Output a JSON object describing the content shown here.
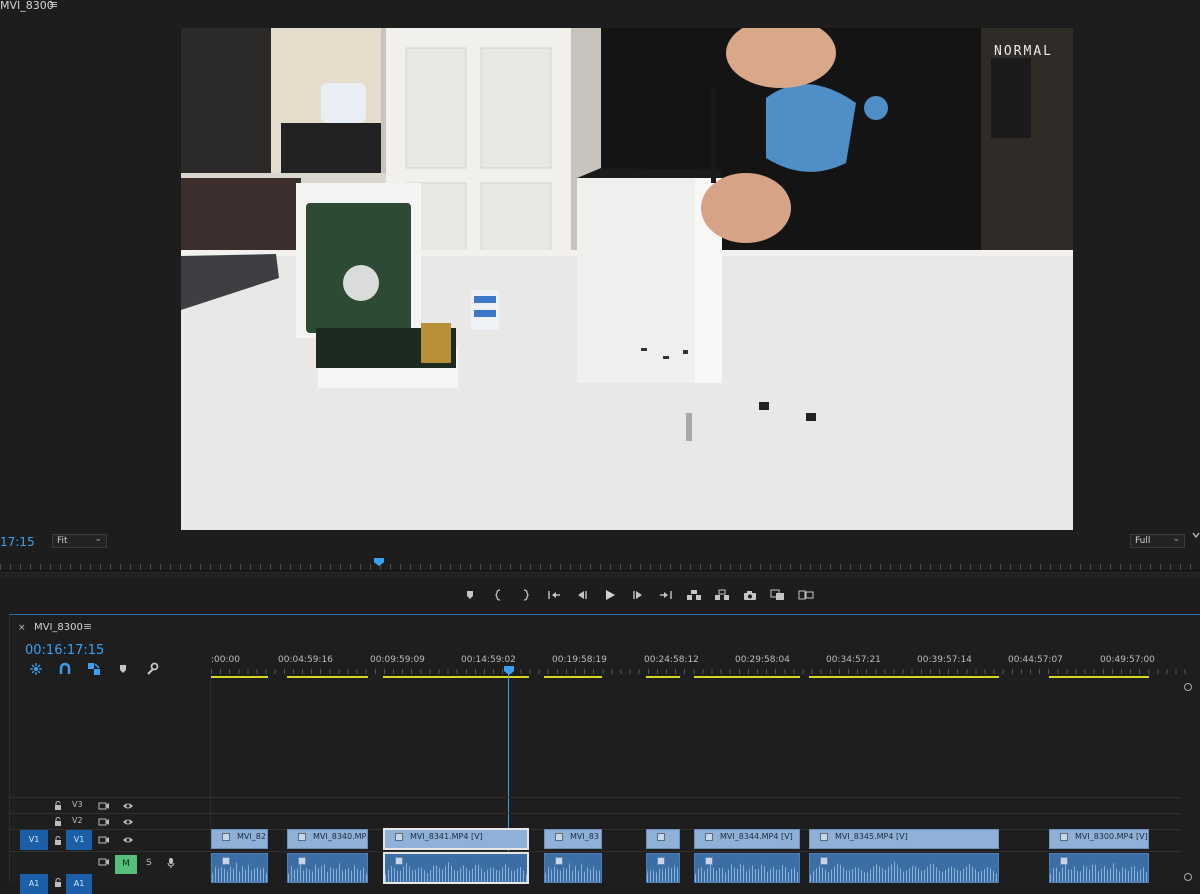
{
  "monitor": {
    "title": "MVI_8300",
    "menu_glyph": "≡",
    "mode_label": "NORMAL",
    "timecode": "17:15",
    "fit_option": "Fit",
    "quality_option": "Full",
    "dropdown_chevron": "⌄"
  },
  "transport": {
    "buttons": [
      "add-marker",
      "mark-in",
      "mark-out",
      "go-to-in",
      "step-back",
      "play",
      "step-forward",
      "go-to-out",
      "lift",
      "extract",
      "export-frame",
      "comparison-view",
      "toggle-proxies"
    ]
  },
  "timeline": {
    "close_glyph": "×",
    "sequence_name": "MVI_8300",
    "menu_glyph": "≡",
    "timecode": "00:16:17:15",
    "ruler_labels": [
      ":00:00",
      "00:04:59:16",
      "00:09:59:09",
      "00:14:59:02",
      "00:19:58:19",
      "00:24:58:12",
      "00:29:58:04",
      "00:34:57:21",
      "00:39:57:14",
      "00:44:57:07",
      "00:49:57:00"
    ],
    "tracks": {
      "v3": {
        "name": "V3"
      },
      "v2": {
        "name": "V2"
      },
      "v1": {
        "name": "V1",
        "source_patch": "V1"
      },
      "a1": {
        "name": "A1",
        "source_patch": "A1",
        "mute": "M",
        "solo": "S"
      }
    },
    "video_clips": [
      {
        "label": "MVI_82"
      },
      {
        "label": "MVI_8340.MP4"
      },
      {
        "label": "MVI_8341.MP4 [V]",
        "selected": true
      },
      {
        "label": "MVI_83"
      },
      {
        "label": ""
      },
      {
        "label": "MVI_8344.MP4 [V]"
      },
      {
        "label": "MVI_8345.MP4 [V]"
      },
      {
        "label": "MVI_8300.MP4 [V]"
      }
    ]
  },
  "colors": {
    "accent_blue": "#3aa0f3",
    "clip_video": "#8fb1d8",
    "clip_audio": "#3c6ea6",
    "in_out_yellow": "#d8d81e",
    "mute_green": "#56c07b",
    "track_target": "#1b5fa8"
  }
}
